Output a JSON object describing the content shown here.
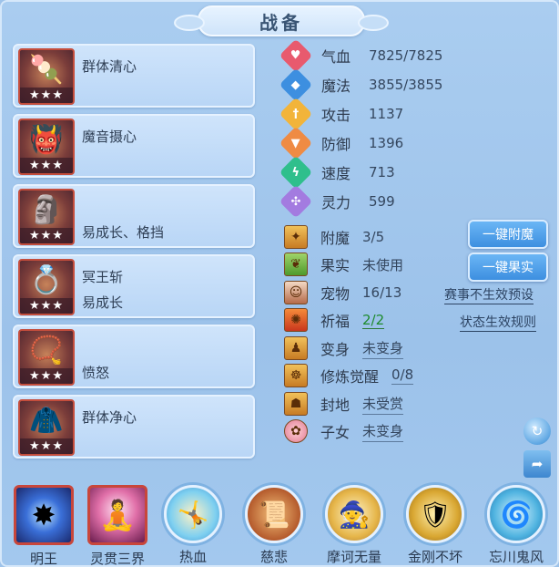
{
  "title": "战备",
  "skills": [
    {
      "line1": "群体清心",
      "line2": "",
      "stars": "★★★",
      "icon": "popsicle-icon"
    },
    {
      "line1": "魔音摄心",
      "line2": "",
      "stars": "★★★",
      "icon": "demon-mask-icon"
    },
    {
      "line1": "",
      "line2": "易成长、格挡",
      "stars": "★★★",
      "icon": "armor-idol-icon"
    },
    {
      "line1": "冥王斩",
      "line2": "易成长",
      "stars": "★★★",
      "icon": "ring-icon"
    },
    {
      "line1": "",
      "line2": "愤怒",
      "stars": "★★★",
      "icon": "bracelet-icon"
    },
    {
      "line1": "群体净心",
      "line2": "",
      "stars": "★★★",
      "icon": "cape-icon"
    }
  ],
  "attributes": [
    {
      "label": "气血",
      "value": "7825/7825",
      "color": "#e85a6e",
      "icon": "heart-icon"
    },
    {
      "label": "魔法",
      "value": "3855/3855",
      "color": "#3d8fe0",
      "icon": "mana-icon"
    },
    {
      "label": "攻击",
      "value": "1137",
      "color": "#f2b43a",
      "icon": "sword-icon"
    },
    {
      "label": "防御",
      "value": "1396",
      "color": "#ef8b43",
      "icon": "shield-icon"
    },
    {
      "label": "速度",
      "value": "713",
      "color": "#2fbf8c",
      "icon": "lightning-icon"
    },
    {
      "label": "灵力",
      "value": "599",
      "color": "#a37be0",
      "icon": "spirit-icon"
    }
  ],
  "items": [
    {
      "label": "附魔",
      "value": "3/5",
      "style": "plain",
      "icon": "enchant-icon"
    },
    {
      "label": "果实",
      "value": "未使用",
      "style": "plain",
      "icon": "fruit-icon"
    },
    {
      "label": "宠物",
      "value": "16/13",
      "style": "plain",
      "icon": "pet-icon"
    },
    {
      "label": "祈福",
      "value": "2/2",
      "style": "green",
      "icon": "blessing-icon"
    },
    {
      "label": "变身",
      "value": "未变身",
      "style": "underline",
      "icon": "transform-icon"
    },
    {
      "label": "修炼觉醒",
      "value": "0/8",
      "style": "underline",
      "icon": "cultivation-icon"
    },
    {
      "label": "封地",
      "value": "未受赏",
      "style": "underline",
      "icon": "fief-icon"
    },
    {
      "label": "子女",
      "value": "未变身",
      "style": "underline",
      "icon": "child-icon"
    }
  ],
  "buttons": {
    "enchant_all": "一键附魔",
    "fruit_all": "一键果实"
  },
  "links": {
    "event_preset": "赛事不生效预设",
    "status_rules": "状态生效规则"
  },
  "bottom_skills": [
    {
      "label": "明王",
      "shape": "square",
      "icon": "blue-orb-icon"
    },
    {
      "label": "灵贯三界",
      "shape": "square",
      "icon": "meditation-icon"
    },
    {
      "label": "热血",
      "shape": "round",
      "icon": "warrior-icon"
    },
    {
      "label": "慈悲",
      "shape": "round",
      "icon": "scroll-icon"
    },
    {
      "label": "摩诃无量",
      "shape": "round",
      "icon": "monk-icon"
    },
    {
      "label": "金刚不坏",
      "shape": "round",
      "icon": "golden-guardian-icon"
    },
    {
      "label": "忘川鬼风",
      "shape": "round",
      "icon": "ghost-wind-icon"
    }
  ]
}
